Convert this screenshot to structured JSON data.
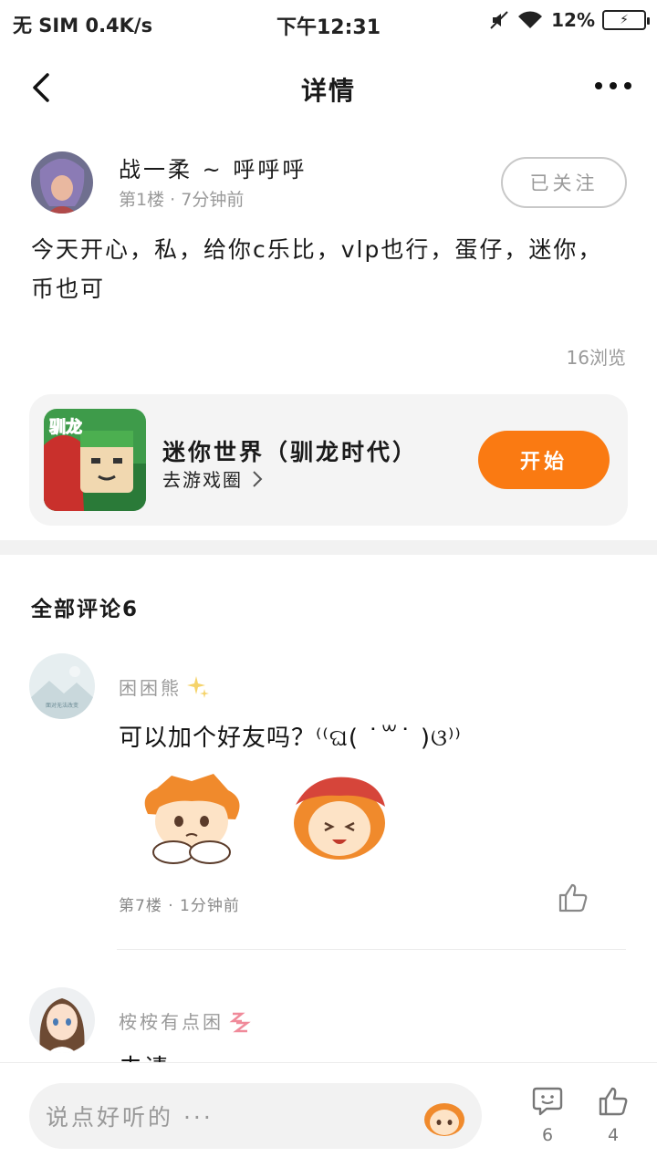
{
  "status_bar": {
    "left": "无 SIM 0.4K/s",
    "time": "下午12:31",
    "battery": "12%"
  },
  "nav": {
    "title": "详情"
  },
  "post": {
    "author": "战一柔 ~ 呼呼呼",
    "floor": "第1楼",
    "time": "7分钟前",
    "follow_label": "已关注",
    "text": "今天开心，私，给你c乐比，vlp也行，蛋仔，迷你，币也可",
    "views": "16浏览"
  },
  "game_card": {
    "name": "迷你世界（驯龙时代）",
    "link": "去游戏圈",
    "start_label": "开始",
    "icon_text": "驯龙",
    "accent": "#fa7a12"
  },
  "comments": {
    "title": "全部评论6",
    "items": [
      {
        "user": "困困熊",
        "text": "可以加个好友吗？⁽⁽ଘ( ˙꒳˙ )ଓ⁾⁾",
        "floor": "第7楼",
        "time": "1分钟前",
        "avatar_caption": "面对无法改变"
      },
      {
        "user": "桉桉有点困",
        "text_peek": "去请"
      }
    ]
  },
  "bottom_bar": {
    "placeholder": "说点好听的 ···",
    "comment_count": "6",
    "like_count": "4"
  }
}
